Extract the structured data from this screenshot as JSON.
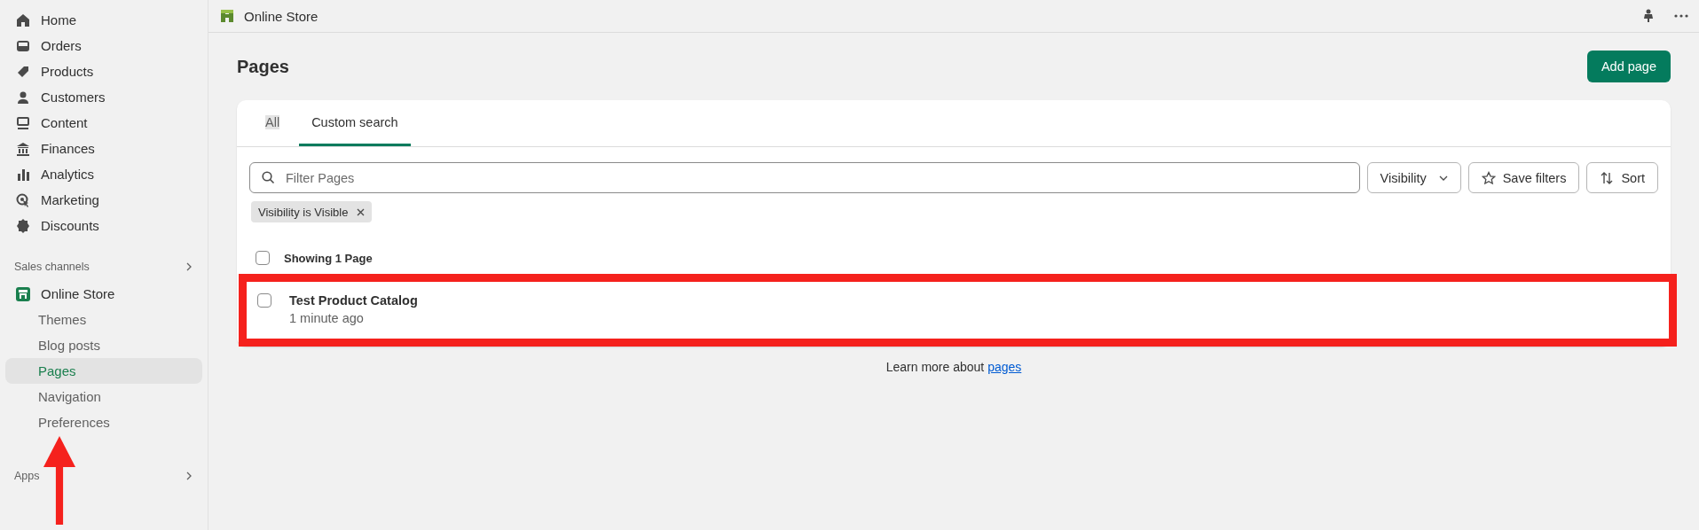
{
  "sidebar": {
    "items": [
      {
        "label": "Home"
      },
      {
        "label": "Orders"
      },
      {
        "label": "Products"
      },
      {
        "label": "Customers"
      },
      {
        "label": "Content"
      },
      {
        "label": "Finances"
      },
      {
        "label": "Analytics"
      },
      {
        "label": "Marketing"
      },
      {
        "label": "Discounts"
      }
    ],
    "sales_channels": {
      "label": "Sales channels",
      "channel": "Online Store",
      "subitems": [
        {
          "label": "Themes",
          "selected": false
        },
        {
          "label": "Blog posts",
          "selected": false
        },
        {
          "label": "Pages",
          "selected": true
        },
        {
          "label": "Navigation",
          "selected": false
        },
        {
          "label": "Preferences",
          "selected": false
        }
      ]
    },
    "apps": {
      "label": "Apps"
    }
  },
  "topbar": {
    "title": "Online Store"
  },
  "page": {
    "title": "Pages",
    "primary_action": "Add page"
  },
  "tabs": [
    {
      "label": "All",
      "selected": false
    },
    {
      "label": "Custom search",
      "selected": true
    }
  ],
  "filter": {
    "placeholder": "Filter Pages",
    "buttons": [
      {
        "label": "Visibility",
        "kind": "dropdown"
      },
      {
        "label": "Save filters",
        "kind": "star"
      },
      {
        "label": "Sort",
        "kind": "sort"
      }
    ],
    "chips": [
      "Visibility is Visible"
    ]
  },
  "list": {
    "header": "Showing 1 Page",
    "header_checked": false,
    "rows": [
      {
        "title": "Test Product Catalog",
        "subtitle": "1 minute ago",
        "checked": false,
        "highlighted": true
      }
    ]
  },
  "footer": {
    "text": "Learn more about ",
    "link": "pages"
  }
}
